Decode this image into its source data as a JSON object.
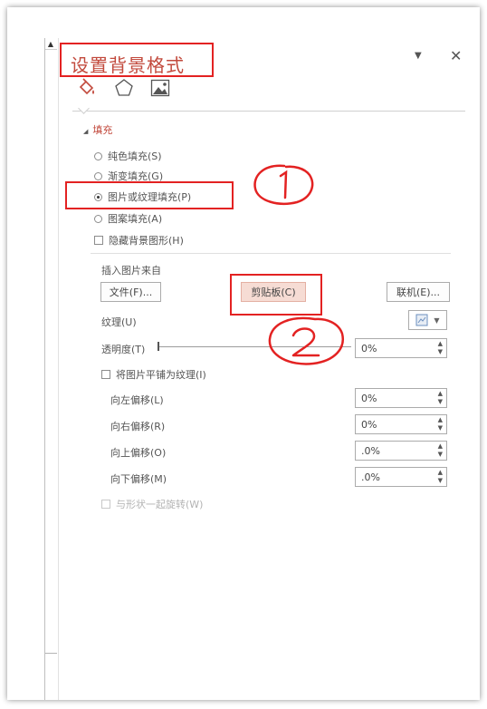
{
  "pane": {
    "title": "设置背景格式",
    "pin_glyph": "▼",
    "close_glyph": "✕",
    "tabs": [
      {
        "icon": "fill-bucket-icon"
      },
      {
        "icon": "pentagon-effects-icon"
      },
      {
        "icon": "picture-icon"
      }
    ]
  },
  "fill": {
    "section_label": "填充",
    "options": [
      {
        "label": "纯色填充(S)",
        "selected": false
      },
      {
        "label": "渐变填充(G)",
        "selected": false
      },
      {
        "label": "图片或纹理填充(P)",
        "selected": true
      },
      {
        "label": "图案填充(A)",
        "selected": false
      }
    ],
    "hide_background_label": "隐藏背景图形(H)"
  },
  "insert": {
    "heading": "插入图片来自",
    "file_button": "文件(F)...",
    "clipboard_button": "剪贴板(C)",
    "online_button": "联机(E)..."
  },
  "texture_label": "纹理(U)",
  "transparency": {
    "label": "透明度(T)",
    "value": "0%",
    "level": 0
  },
  "tile_label": "将图片平铺为纹理(I)",
  "offsets": [
    {
      "label": "向左偏移(L)",
      "value": "0%"
    },
    {
      "label": "向右偏移(R)",
      "value": "0%"
    },
    {
      "label": "向上偏移(O)",
      "value": ".0%"
    },
    {
      "label": "向下偏移(M)",
      "value": ".0%"
    }
  ],
  "rotate_label": "与形状一起旋转(W)",
  "annotations": {
    "one": "①",
    "two": "②"
  },
  "colors": {
    "accent": "#c2493c",
    "annotation_red": "#e32222",
    "active_button": "#f6dcd4"
  }
}
